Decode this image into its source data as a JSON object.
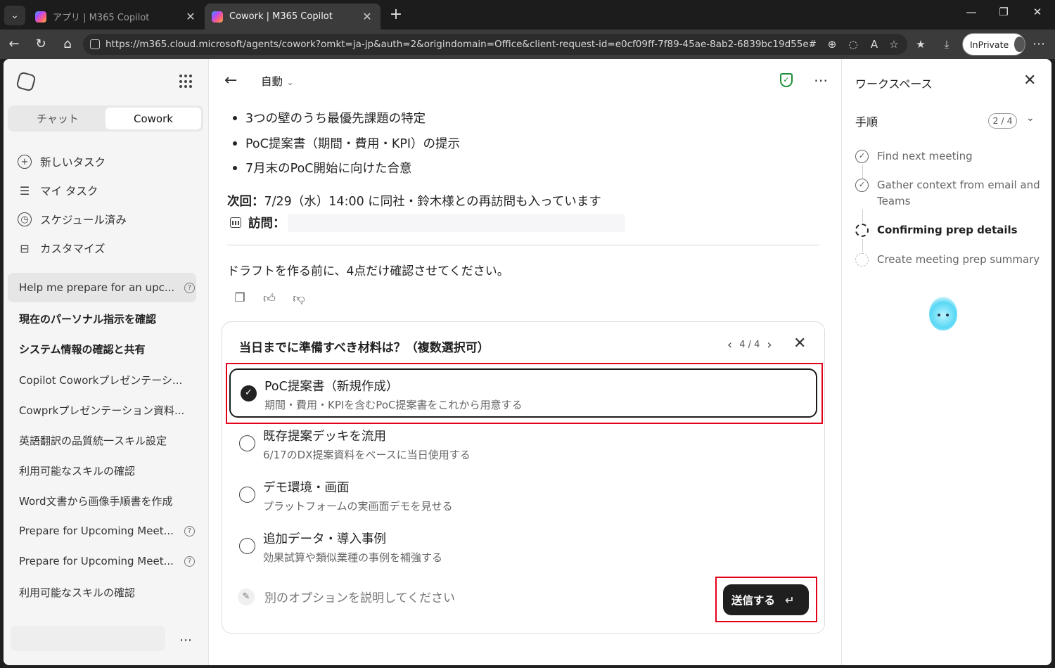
{
  "browser": {
    "tabs": [
      {
        "label": "アプリ | M365 Copilot",
        "active": false
      },
      {
        "label": "Cowork | M365 Copilot",
        "active": true
      }
    ],
    "url": "https://m365.cloud.microsoft/agents/cowork?omkt=ja-jp&auth=2&origindomain=Office&client-request-id=e0cf09ff-7f89-45ae-8ab2-6839bc19d55e#/task...",
    "inprivate_label": "InPrivate"
  },
  "sidebar": {
    "mode_tabs": [
      "チャット",
      "Cowork"
    ],
    "active_mode": "Cowork",
    "nav": [
      {
        "icon": "plus-circle-icon",
        "label": "新しいタスク"
      },
      {
        "icon": "checklist-icon",
        "label": "マイ タスク"
      },
      {
        "icon": "clock-icon",
        "label": "スケジュール済み"
      },
      {
        "icon": "toolbox-icon",
        "label": "カスタマイズ"
      }
    ],
    "history": [
      {
        "label": "Help me prepare for an upc...",
        "bold": false,
        "help": true,
        "selected": true
      },
      {
        "label": "現在のパーソナル指示を確認",
        "bold": true,
        "help": false
      },
      {
        "label": "システム情報の確認と共有",
        "bold": true,
        "help": false
      },
      {
        "label": "Copilot Coworkプレゼンテーシ...",
        "bold": false,
        "help": false
      },
      {
        "label": "Cowprkプレゼンテーション資料...",
        "bold": false,
        "help": false
      },
      {
        "label": "英語翻訳の品質統一スキル設定",
        "bold": false,
        "help": false
      },
      {
        "label": "利用可能なスキルの確認",
        "bold": false,
        "help": false
      },
      {
        "label": "Word文書から画像手順書を作成",
        "bold": false,
        "help": false
      },
      {
        "label": "Prepare for Upcoming Meet...",
        "bold": false,
        "help": true
      },
      {
        "label": "Prepare for Upcoming Meet...",
        "bold": false,
        "help": true
      },
      {
        "label": "利用可能なスキルの確認",
        "bold": false,
        "help": false
      }
    ]
  },
  "main": {
    "mode_label": "自動",
    "bullets": [
      "3つの壁のうち最優先課題の特定",
      "PoC提案書（期間・費用・KPI）の提示",
      "7月末のPoC開始に向けた合意"
    ],
    "next_visit_label": "次回：",
    "next_visit_text": "7/29（水）14:00 に同社・鈴木様との再訪問も入っています",
    "visit_label": "訪問：",
    "draft_prompt": "ドラフトを作る前に、4点だけ確認させてください。"
  },
  "question": {
    "title": "当日までに準備すべき材料は？（複数選択可）",
    "pager": "4 / 4",
    "options": [
      {
        "title": "PoC提案書（新規作成）",
        "desc": "期間・費用・KPIを含むPoC提案書をこれから用意する",
        "selected": true
      },
      {
        "title": "既存提案デッキを流用",
        "desc": "6/17のDX提案資料をベースに当日使用する",
        "selected": false
      },
      {
        "title": "デモ環境・画面",
        "desc": "プラットフォームの実画面デモを見せる",
        "selected": false
      },
      {
        "title": "追加データ・導入事例",
        "desc": "効果試算や類似業種の事例を補強する",
        "selected": false
      }
    ],
    "other_placeholder": "別のオプションを説明してください",
    "submit_label": "送信する"
  },
  "workspace": {
    "title": "ワークスペース",
    "steps_title": "手順",
    "steps_count": "2 / 4",
    "steps": [
      {
        "label": "Find next meeting",
        "status": "done"
      },
      {
        "label": "Gather context from email and Teams",
        "status": "done"
      },
      {
        "label": "Confirming prep details",
        "status": "active"
      },
      {
        "label": "Create meeting prep summary",
        "status": "pending"
      }
    ]
  },
  "colors": {
    "highlight_box": "#e3001b",
    "shield_green": "#1e8f3a",
    "submit_button": "#1f1f1f"
  }
}
